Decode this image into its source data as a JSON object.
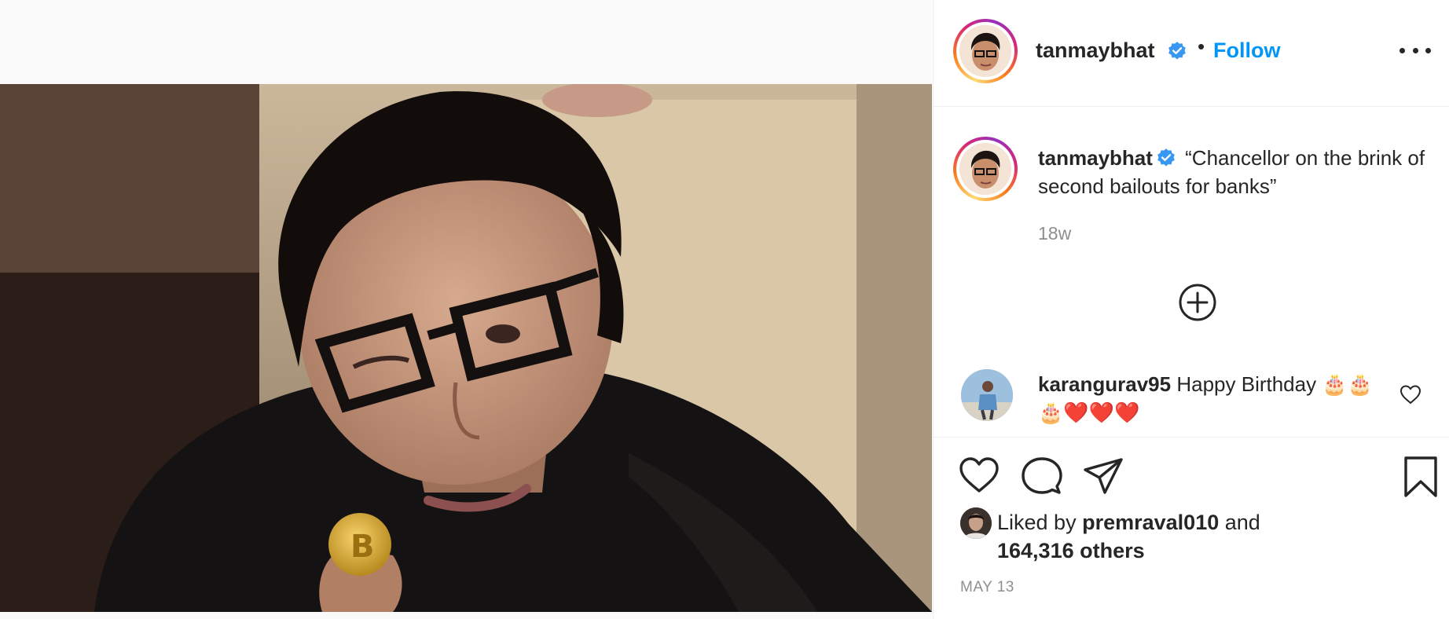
{
  "post": {
    "username": "tanmaybhat",
    "follow_label": "Follow",
    "separator": "•",
    "caption": "“Chancellor on the brink of second bailouts for banks”",
    "age": "18w",
    "date": "MAY 13"
  },
  "comment": {
    "username": "karangurav95",
    "text": "Happy Birthday 🎂🎂🎂❤️❤️❤️"
  },
  "likes": {
    "prefix": "Liked by",
    "liker": "premraval010",
    "joiner": "and",
    "others": "164,316 others"
  },
  "icons": {
    "verified": "verified-badge-icon",
    "more": "more-options-icon",
    "load_more": "plus-circle-icon",
    "heart": "heart-icon",
    "comment": "comment-bubble-icon",
    "share": "paper-plane-icon",
    "save": "bookmark-icon"
  },
  "colors": {
    "accent": "#0095f6",
    "verified": "#3897f0",
    "muted": "#8e8e8e",
    "text": "#262626"
  }
}
